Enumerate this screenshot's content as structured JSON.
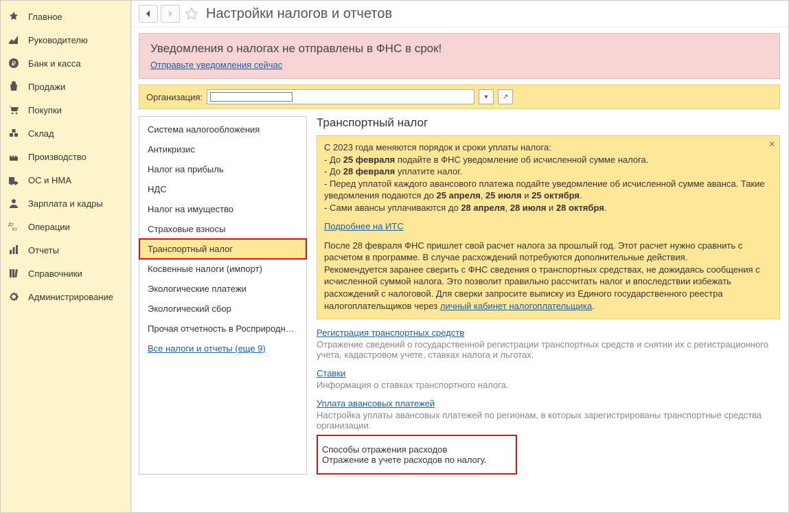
{
  "sidebar": {
    "items": [
      {
        "id": "main",
        "label": "Главное"
      },
      {
        "id": "manager",
        "label": "Руководителю"
      },
      {
        "id": "bank",
        "label": "Банк и касса"
      },
      {
        "id": "sales",
        "label": "Продажи"
      },
      {
        "id": "purchases",
        "label": "Покупки"
      },
      {
        "id": "warehouse",
        "label": "Склад"
      },
      {
        "id": "production",
        "label": "Производство"
      },
      {
        "id": "fixed-assets",
        "label": "ОС и НМА"
      },
      {
        "id": "payroll",
        "label": "Зарплата и кадры"
      },
      {
        "id": "operations",
        "label": "Операции"
      },
      {
        "id": "reports",
        "label": "Отчеты"
      },
      {
        "id": "directories",
        "label": "Справочники"
      },
      {
        "id": "admin",
        "label": "Администрирование"
      }
    ]
  },
  "page": {
    "title": "Настройки налогов и отчетов"
  },
  "alert": {
    "title": "Уведомления о налогах не отправлены в ФНС в срок!",
    "link": "Отправьте уведомления сейчас"
  },
  "org": {
    "label": "Организация:"
  },
  "taxList": {
    "items": [
      "Система налогообложения",
      "Антикризис",
      "Налог на прибыль",
      "НДС",
      "Налог на имущество",
      "Страховые взносы",
      "Транспортный налог",
      "Косвенные налоги (импорт)",
      "Экологические платежи",
      "Экологический сбор",
      "Прочая отчетность в Росприроднад..."
    ],
    "moreLink": "Все налоги и отчеты (еще 9)"
  },
  "detail": {
    "heading": "Транспортный налог",
    "info": {
      "line1": "С 2023 года меняются порядок и сроки уплаты налога:",
      "line2a": " - До ",
      "line2b": "25 февраля",
      "line2c": " подайте в ФНС уведомление об исчисленной сумме налога.",
      "line3a": " - До ",
      "line3b": "28 февраля",
      "line3c": " уплатите налог.",
      "line4a": " - Перед уплатой каждого авансового платежа подайте уведомление об исчисленной сумме аванса. Такие уведомления подаются до ",
      "line4b": "25 апреля",
      "line4c": ", ",
      "line4d": "25 июля",
      "line4e": " и ",
      "line4f": "25 октября",
      "line4g": ".",
      "line5a": " - Сами авансы уплачиваются до ",
      "line5b": "28 апреля",
      "line5c": ", ",
      "line5d": "28 июля",
      "line5e": " и ",
      "line5f": "28 октября",
      "line5g": ".",
      "moreLink": "Подробнее на ИТС",
      "para2a": "После 28 февраля ФНС пришлет свой расчет налога за прошлый год. Этот расчет нужно сравнить с расчетом в программе. В случае расхождений потребуются дополнительные действия.",
      "para2b": "Рекомендуется заранее сверить с ФНС сведения о транспортных средствах, не дожидаясь сообщения с исчисленной суммой налога. Это позволит правильно рассчитать налог и впоследствии избежать расхождений с налоговой. Для сверки запросите выписку из Единого государственного реестра налогоплательщиков через ",
      "para2link": "личный кабинет налогоплательщика",
      "para2c": "."
    },
    "sec1": {
      "link": "Регистрация транспортных средств",
      "desc": "Отражение сведений о государственной регистрации транспортных средств и снятии их с регистрационного учета, кадастровом учете, ставках налога и льготах."
    },
    "sec2": {
      "link": "Ставки",
      "desc": "Информация о ставках транспортного налога."
    },
    "sec3": {
      "link": "Уплата авансовых платежей",
      "desc": "Настройка уплаты авансовых платежей по регионам, в которых зарегистрированы транспортные средства организации."
    },
    "sec4": {
      "link": "Способы отражения расходов",
      "desc": "Отражение в учете расходов по налогу."
    }
  }
}
